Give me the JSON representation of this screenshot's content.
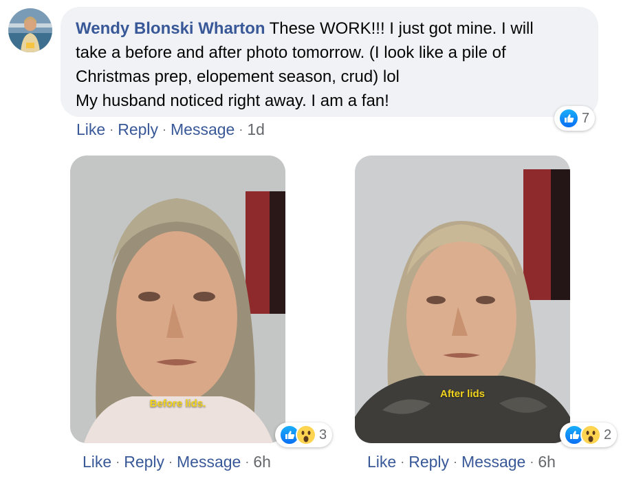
{
  "comment": {
    "author": "Wendy Blonski Wharton",
    "text_line1": "These WORK!!! I just got mine. I will",
    "text_line2": "take a before and after photo tomorrow. (I look like a pile of",
    "text_line3": "Christmas prep, elopement season, crud) lol",
    "text_line4": "My husband noticed right away. I am a fan!",
    "reaction_count": "7",
    "actions": {
      "like": "Like",
      "reply": "Reply",
      "message": "Message",
      "time": "1d"
    }
  },
  "replies": [
    {
      "caption": "Before lids.",
      "reaction_count": "3",
      "actions": {
        "like": "Like",
        "reply": "Reply",
        "message": "Message",
        "time": "6h"
      }
    },
    {
      "caption": "After lids",
      "reaction_count": "2",
      "actions": {
        "like": "Like",
        "reply": "Reply",
        "message": "Message",
        "time": "6h"
      }
    }
  ],
  "colors": {
    "link": "#385898",
    "bubble": "#f0f2f5",
    "meta": "#65676b",
    "caption": "#f2d31d",
    "like": "#1877f2"
  },
  "icons": {
    "like_reaction": "thumbs-up-icon",
    "wow_reaction": "wow-face-icon"
  }
}
